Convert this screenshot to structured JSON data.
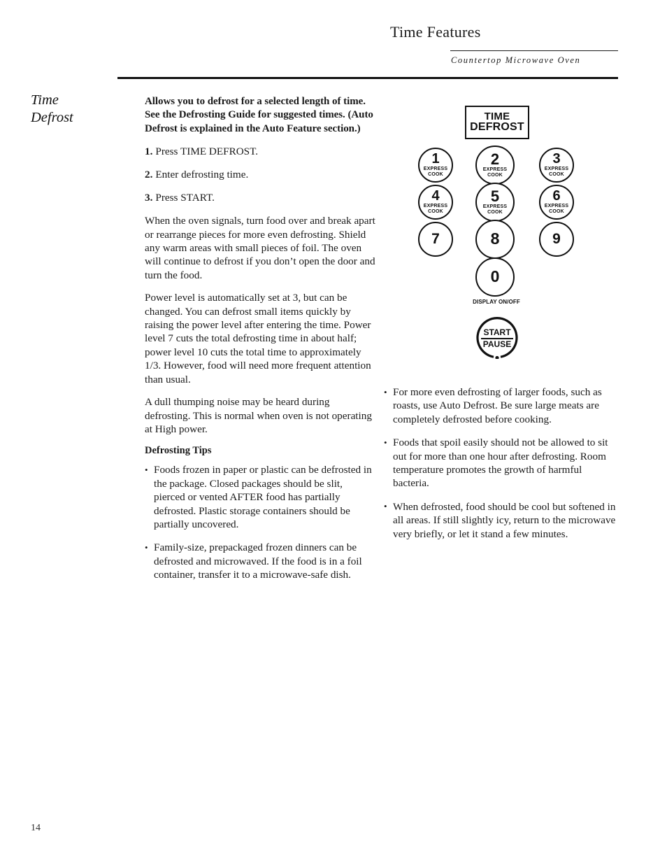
{
  "header": {
    "title": "Time Features",
    "subtitle": "Countertop Microwave Oven"
  },
  "side_heading": {
    "line1": "Time",
    "line2": "Defrost"
  },
  "left_column": {
    "lead": "Allows you to defrost for a selected length of time. See the Defrosting Guide for suggested times. (Auto Defrost is explained in the Auto Feature section.)",
    "steps": [
      {
        "num": "1.",
        "text": "Press TIME DEFROST."
      },
      {
        "num": "2.",
        "text": "Enter defrosting time."
      },
      {
        "num": "3.",
        "text": "Press START."
      }
    ],
    "paragraphs": [
      "When the oven signals, turn food over and break apart or rearrange pieces for more even defrosting. Shield any warm areas with small pieces of foil. The oven will continue to defrost if you don’t open the door and turn the food.",
      "Power level is automatically set at 3, but can be changed. You can defrost small items quickly by raising the power level after entering the time. Power level 7 cuts the total defrosting time in about half; power level 10 cuts the total time to approximately 1/3. However, food will need more frequent attention than usual.",
      "A dull thumping noise may be heard during defrosting. This is normal when oven is not operating at High power."
    ],
    "tips_heading": "Defrosting Tips",
    "tips": [
      "Foods frozen in paper or plastic can be defrosted in the package. Closed packages should be slit, pierced or vented AFTER food has partially defrosted. Plastic storage containers should be partially uncovered.",
      "Family-size, prepackaged frozen dinners can be defrosted and microwaved. If the food is in a foil container, transfer it to a microwave-safe dish."
    ]
  },
  "right_column": {
    "tips": [
      "For more even defrosting of larger foods, such as roasts, use Auto Defrost. Be sure large meats are completely defrosted before cooking.",
      "Foods that spoil easily should not be allowed to sit out for more than one hour after defrosting. Room temperature promotes the growth of harmful bacteria.",
      "When defrosted, food should be cool but softened in all areas. If still slightly icy, return to the microwave very briefly, or let it stand a few minutes."
    ]
  },
  "keypad": {
    "time_defrost": {
      "line1": "TIME",
      "line2": "DEFROST"
    },
    "express_cook_label": {
      "line1": "EXPRESS",
      "line2": "COOK"
    },
    "keys": [
      {
        "digit": "1",
        "express_cook": true
      },
      {
        "digit": "2",
        "express_cook": true
      },
      {
        "digit": "3",
        "express_cook": true
      },
      {
        "digit": "4",
        "express_cook": true
      },
      {
        "digit": "5",
        "express_cook": true
      },
      {
        "digit": "6",
        "express_cook": true
      },
      {
        "digit": "7",
        "express_cook": false
      },
      {
        "digit": "8",
        "express_cook": false
      },
      {
        "digit": "9",
        "express_cook": false
      },
      {
        "digit": "0",
        "express_cook": false
      }
    ],
    "display_label": "DISPLAY ON/OFF",
    "start_pause": {
      "line1": "START",
      "line2": "PAUSE"
    }
  },
  "footer": {
    "page_number": "14"
  },
  "colors": {
    "ink": "#1a1a1a",
    "rule": "#111111",
    "paper": "#ffffff"
  }
}
